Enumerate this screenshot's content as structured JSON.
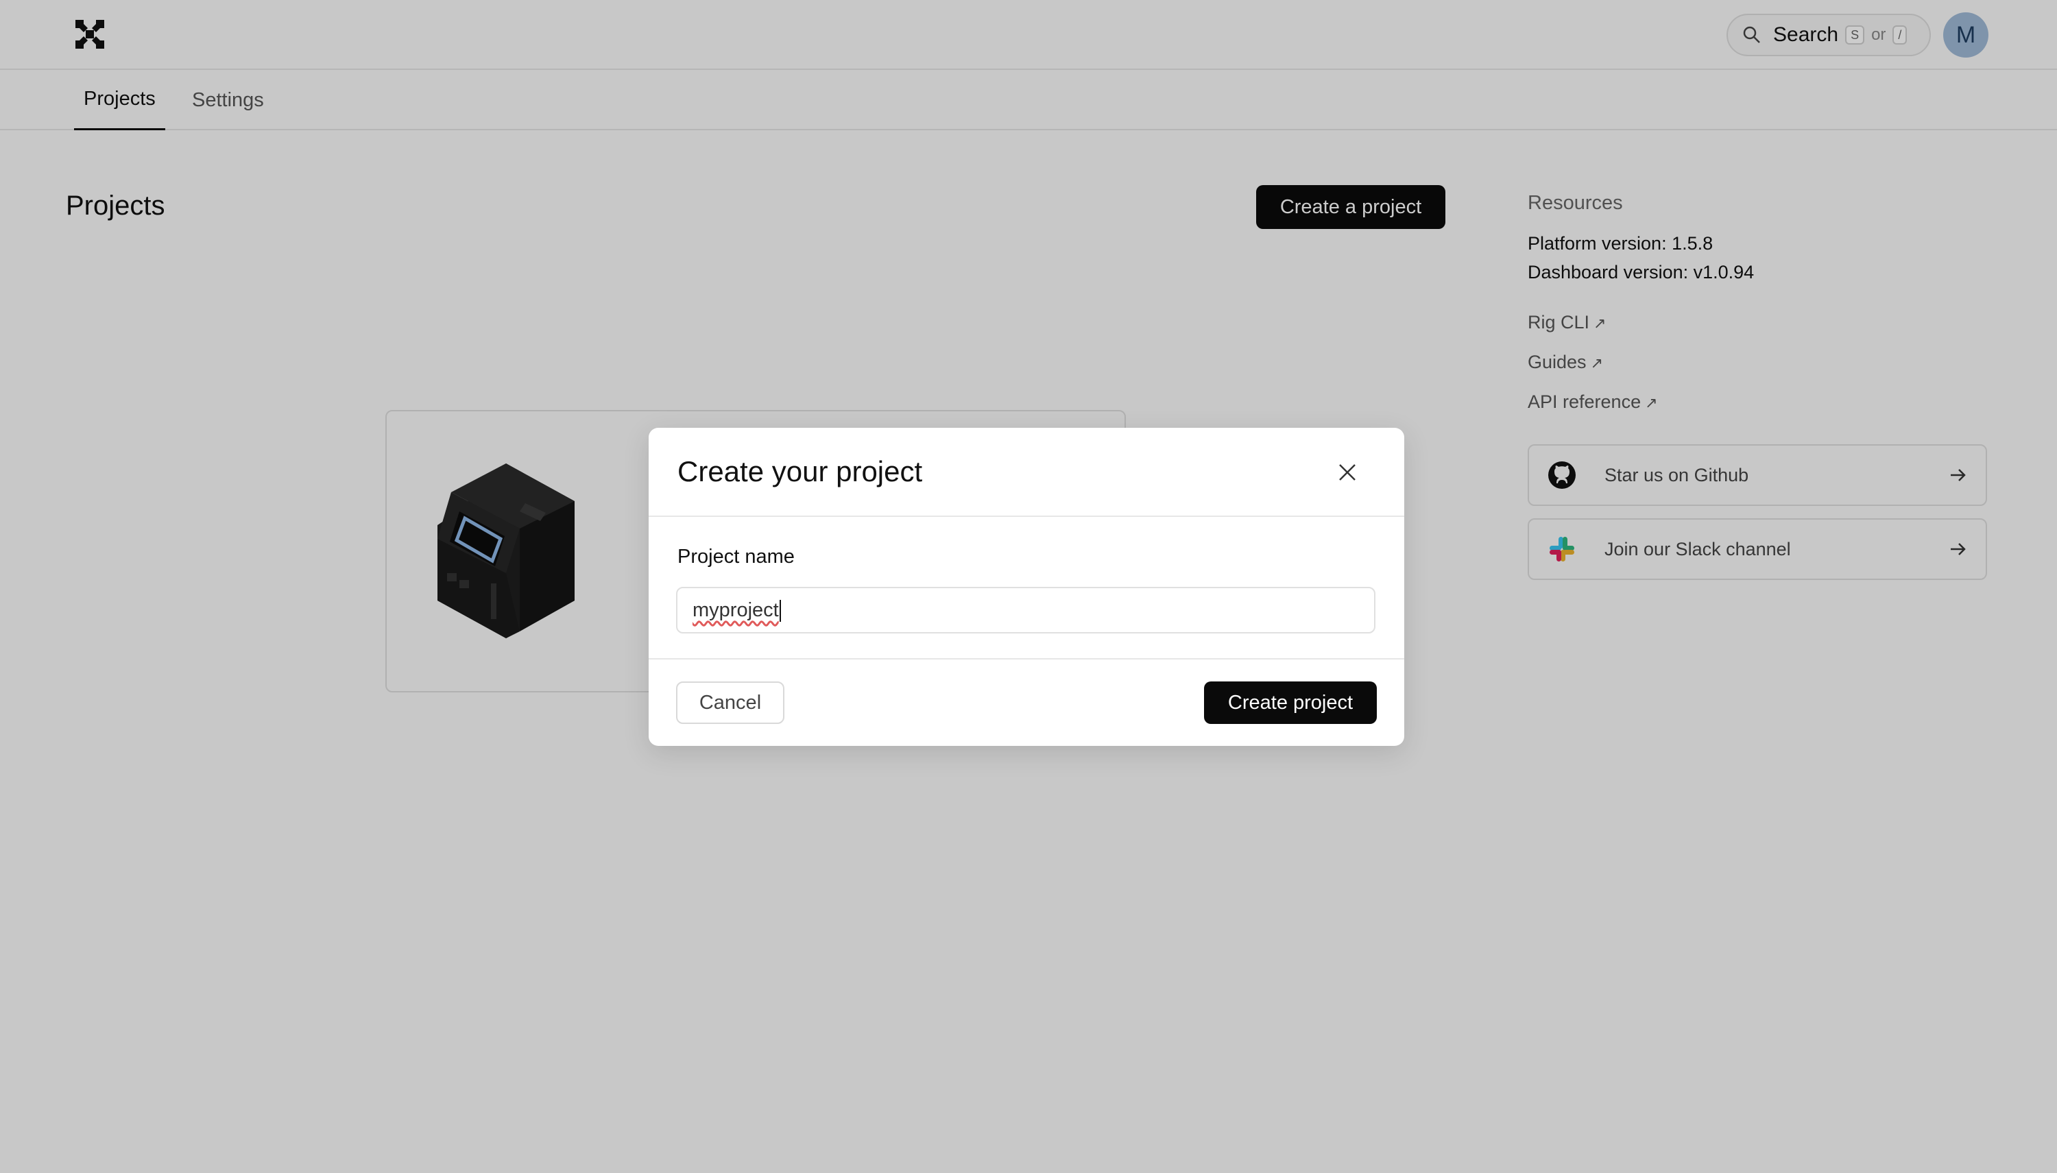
{
  "header": {
    "search_label": "Search",
    "search_key_1": "S",
    "search_or": "or",
    "search_key_2": "/",
    "avatar_initial": "M"
  },
  "tabs": [
    {
      "label": "Projects",
      "active": true
    },
    {
      "label": "Settings",
      "active": false
    }
  ],
  "main": {
    "title": "Projects",
    "create_button": "Create a project"
  },
  "resources": {
    "title": "Resources",
    "platform_version": "Platform version: 1.5.8",
    "dashboard_version": "Dashboard version: v1.0.94",
    "links": [
      {
        "label": "Rig CLI",
        "icon": "external-link-icon"
      },
      {
        "label": "Guides",
        "icon": "external-link-icon"
      },
      {
        "label": "API reference",
        "icon": "external-link-icon"
      }
    ],
    "cards": [
      {
        "label": "Star us on Github",
        "icon": "github-icon"
      },
      {
        "label": "Join our Slack channel",
        "icon": "slack-icon"
      }
    ]
  },
  "modal": {
    "title": "Create your project",
    "field_label": "Project name",
    "field_value": "myproject",
    "cancel_label": "Cancel",
    "submit_label": "Create project"
  },
  "colors": {
    "accent": "#0a0a0a",
    "avatar_bg": "#9fb9d6",
    "screen_glow": "#8fb8e8"
  }
}
